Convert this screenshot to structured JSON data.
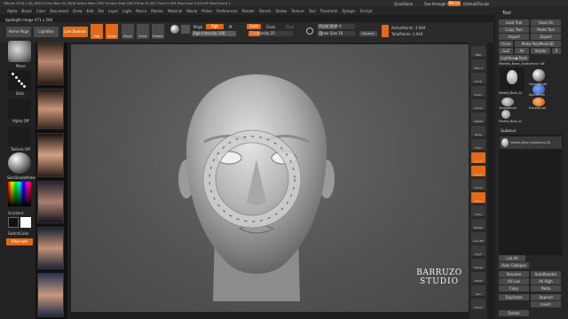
{
  "titlebar": {
    "text": "ZBrush 2018.1    QS_62023    Free Mem 20.34GB    Active Mem 2397    Scratch Disk 336    ZTime 32.502    Timer 0.406    PolyCount 4.524 KP    MeshCount 1",
    "quicksave": "QuickSave",
    "seethrough": "See-through  0",
    "menus_btn": "Menus",
    "default_zscript": "DefaultZScript"
  },
  "menubar": [
    "Alpha",
    "Brush",
    "Color",
    "Document",
    "Draw",
    "Edit",
    "File",
    "Layer",
    "Light",
    "Macro",
    "Marker",
    "Material",
    "Movie",
    "Picker",
    "Preferences",
    "Render",
    "Stencil",
    "Stroke",
    "Texture",
    "Tool",
    "Transform",
    "Zplugin",
    "Zscript"
  ],
  "spotlight_label": "Spotlight image 471 x 594",
  "toolbar": {
    "home_page": "Home Page",
    "lightbox": "LightBox",
    "live_boolean": "Live Boolean",
    "edit": "Edit",
    "draw": "Draw",
    "move": "Move",
    "scale": "Scale",
    "rotate": "Rotate",
    "mrgb": "Mrgb",
    "rgb": "Rgb",
    "m": "M",
    "rgb_intensity": "Rgb Intensity 100",
    "zadd": "Zadd",
    "zsub": "Zsub",
    "zcut": "Zcut",
    "z_intensity": "Z Intensity 25",
    "focal_shift": "Focal Shift 0",
    "draw_size": "Draw Size 16",
    "dynamic": "Dynamic",
    "active_points": "ActivePoints: 2,944",
    "total_points": "TotalPoints: 2,944"
  },
  "left_shelf": {
    "brush_label": "Move",
    "stroke_label": "Dots",
    "alpha_label": "Alpha Off",
    "texture_label": "Texture Off",
    "material_label": "SkinShadeMaterial",
    "gradient_label": "Gradient",
    "switch_color": "SwitchColor",
    "alternate": "Alternate"
  },
  "canvas": {
    "watermark_line1": "BARRUZO",
    "watermark_line2": "STUDIO"
  },
  "right_shelf": [
    "BPR",
    "SPix 3",
    "Scroll",
    "Zoom",
    "Actual",
    "AAHalf",
    "Persp",
    "Floor",
    "Local",
    "Gizmo",
    "Frame",
    "Move",
    "Scale",
    "Rotate",
    "Line Fill",
    "PolyF",
    "Transp",
    "Ghost",
    "Solo",
    "Xpose"
  ],
  "tool_panel": {
    "title": "Tool",
    "load_tool": "Load Tool",
    "save_as": "Save As",
    "copy_tool": "Copy Tool",
    "paste_tool": "Paste Tool",
    "import": "Import",
    "export": "Export",
    "clone": "Clone",
    "make_polymesh": "Make PolyMesh3D",
    "goz": "GoZ",
    "all": "All",
    "visible": "Visible",
    "r": "R",
    "lightbox_tools": "Lightbox▶Tools",
    "current_tool": "Modelo_Base_Anatomico: 48",
    "tools": [
      "Modelo_Base_Ar",
      "SphereBrush",
      "AlphaBrush",
      "SimpleBrush",
      "EraserBrush",
      "Modelo_Base_Ar"
    ],
    "subtool_title": "Subtool",
    "subtool_name": "Modelo_Base_Anatomico_00",
    "list_all": "List All",
    "auto_collapse": "Auto Collapse",
    "rename": "Rename",
    "autoreorder": "AutoReorder",
    "all_low": "All Low",
    "all_high": "All High",
    "copy": "Copy",
    "paste": "Paste",
    "append": "Append",
    "duplicate": "Duplicate",
    "insert": "Insert",
    "delete": "Delete"
  }
}
